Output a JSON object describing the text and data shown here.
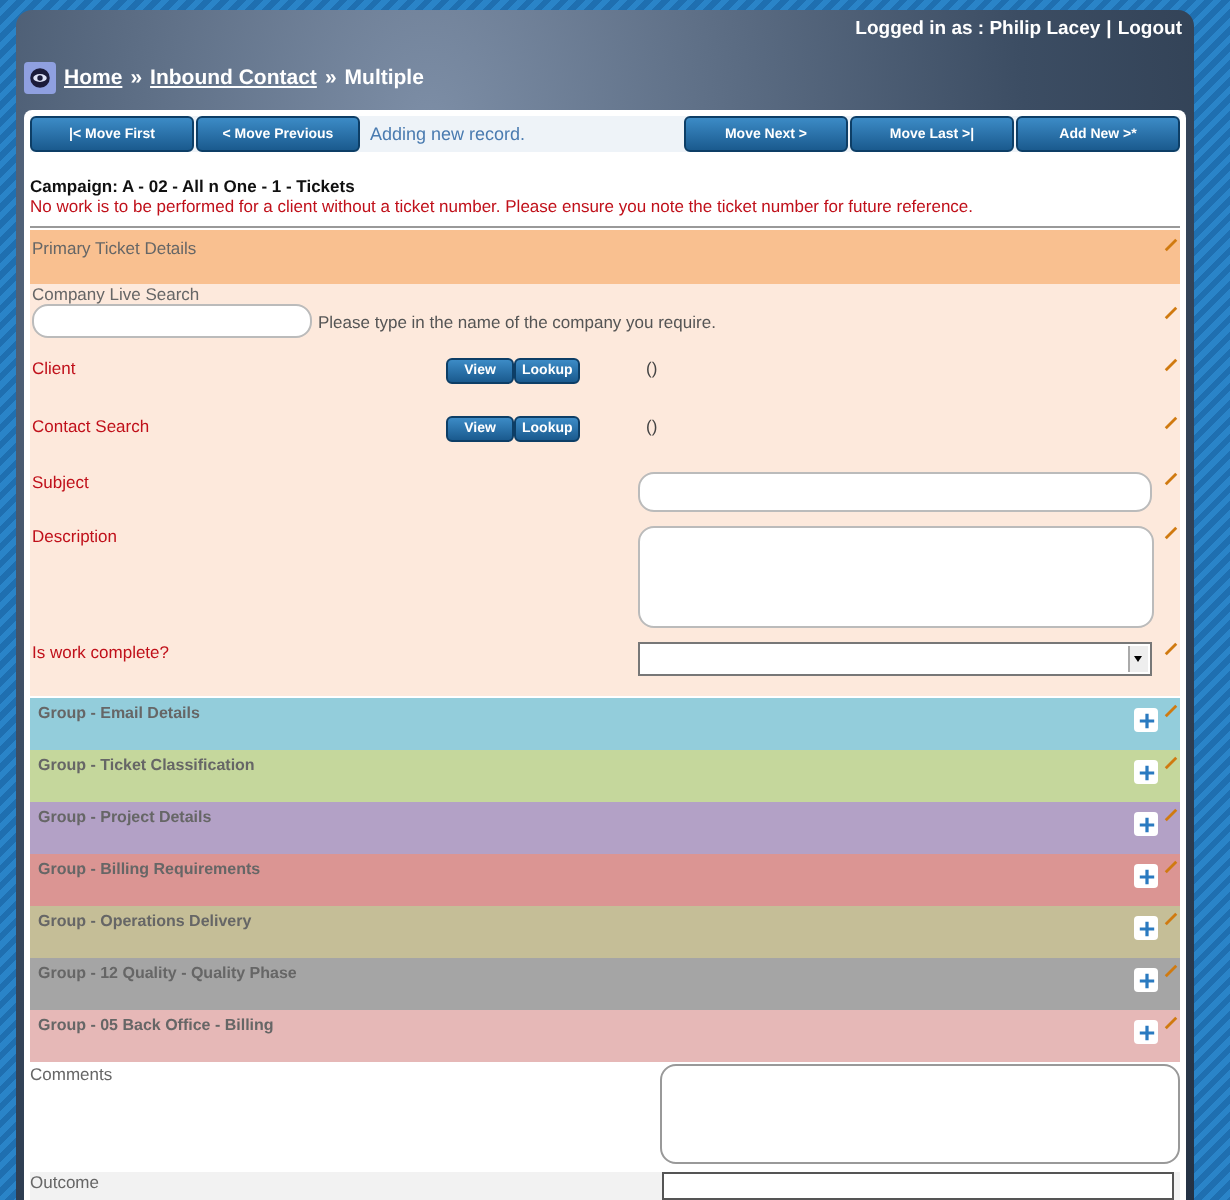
{
  "header": {
    "user_text": "Logged in as : Philip Lacey",
    "separator": "|",
    "logout": "Logout",
    "breadcrumb": [
      {
        "label": "Home",
        "link": true
      },
      {
        "label": "»",
        "link": false
      },
      {
        "label": "Inbound Contact",
        "link": true
      },
      {
        "label": "»",
        "link": false
      },
      {
        "label": "Multiple",
        "link": false
      }
    ]
  },
  "nav": {
    "left_buttons": [
      "|< Move First",
      "< Move Previous"
    ],
    "status": "Adding new record.",
    "right_buttons": [
      "Move Next >",
      "Move Last >|",
      "Add New >*"
    ]
  },
  "campaign": "Campaign: A - 02 - All n One - 1 - Tickets",
  "notice": "No work is to be performed for a client without a ticket number. Please ensure you note the ticket number for future reference.",
  "primary_section": {
    "title": "Primary Ticket Details"
  },
  "fields": [
    {
      "kind": "search",
      "label": "Company Live Search",
      "required": false,
      "hint": "Please type in the name of the company you require."
    },
    {
      "kind": "lookup",
      "label": "Client",
      "required": true,
      "buttons": [
        "View",
        "Lookup"
      ],
      "value": "()"
    },
    {
      "kind": "lookup",
      "label": "Contact Search",
      "required": true,
      "buttons": [
        "View",
        "Lookup"
      ],
      "value": "()"
    },
    {
      "kind": "text",
      "label": "Subject",
      "required": true
    },
    {
      "kind": "textarea",
      "label": "Description",
      "required": true
    },
    {
      "kind": "select",
      "label": "Is work complete?",
      "required": true
    }
  ],
  "groups": [
    {
      "title": "Group - Email Details",
      "color": "#93cddb",
      "expanded": false
    },
    {
      "title": "Group - Ticket Classification",
      "color": "#c5d79c",
      "expanded": false
    },
    {
      "title": "Group - Project Details",
      "color": "#b3a1c6",
      "expanded": false
    },
    {
      "title": "Group - Billing Requirements",
      "color": "#db9593",
      "expanded": false
    },
    {
      "title": "Group - Operations Delivery",
      "color": "#c5be97",
      "expanded": false
    },
    {
      "title": "Group - 12 Quality - Quality Phase",
      "color": "#a5a5a5",
      "expanded": false
    },
    {
      "title": "Group - 05 Back Office - Billing",
      "color": "#e6b8b7",
      "expanded": false
    }
  ],
  "comments": {
    "label": "Comments"
  },
  "outcome": {
    "label": "Outcome"
  }
}
